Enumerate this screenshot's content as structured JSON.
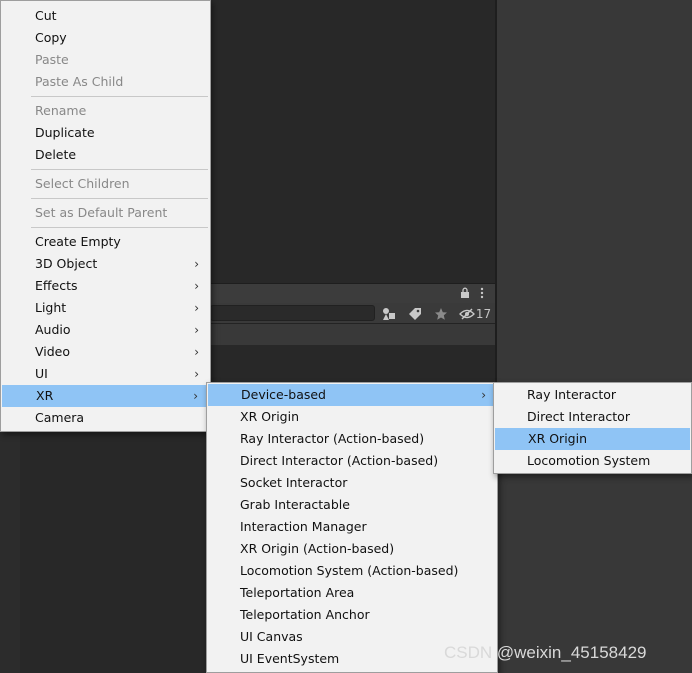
{
  "main_menu": {
    "items": [
      {
        "label": "Cut",
        "enabled": true
      },
      {
        "label": "Copy",
        "enabled": true
      },
      {
        "label": "Paste",
        "enabled": false
      },
      {
        "label": "Paste As Child",
        "enabled": false
      },
      {
        "label": "Rename",
        "enabled": false
      },
      {
        "label": "Duplicate",
        "enabled": true
      },
      {
        "label": "Delete",
        "enabled": true
      },
      {
        "label": "Select Children",
        "enabled": false
      },
      {
        "label": "Set as Default Parent",
        "enabled": false
      },
      {
        "label": "Create Empty",
        "enabled": true
      },
      {
        "label": "3D Object",
        "enabled": true,
        "submenu": true
      },
      {
        "label": "Effects",
        "enabled": true,
        "submenu": true
      },
      {
        "label": "Light",
        "enabled": true,
        "submenu": true
      },
      {
        "label": "Audio",
        "enabled": true,
        "submenu": true
      },
      {
        "label": "Video",
        "enabled": true,
        "submenu": true
      },
      {
        "label": "UI",
        "enabled": true,
        "submenu": true
      },
      {
        "label": "XR",
        "enabled": true,
        "submenu": true,
        "highlighted": true
      },
      {
        "label": "Camera",
        "enabled": true
      }
    ]
  },
  "xr_menu": {
    "items": [
      {
        "label": "Device-based",
        "submenu": true,
        "highlighted": true
      },
      {
        "label": "XR Origin"
      },
      {
        "label": "Ray Interactor (Action-based)"
      },
      {
        "label": "Direct Interactor (Action-based)"
      },
      {
        "label": "Socket Interactor"
      },
      {
        "label": "Grab Interactable"
      },
      {
        "label": "Interaction Manager"
      },
      {
        "label": "XR Origin (Action-based)"
      },
      {
        "label": "Locomotion System (Action-based)"
      },
      {
        "label": "Teleportation Area"
      },
      {
        "label": "Teleportation Anchor"
      },
      {
        "label": "UI Canvas"
      },
      {
        "label": "UI EventSystem"
      }
    ]
  },
  "device_menu": {
    "items": [
      {
        "label": "Ray Interactor"
      },
      {
        "label": "Direct Interactor"
      },
      {
        "label": "XR Origin",
        "highlighted": true
      },
      {
        "label": "Locomotion System"
      }
    ]
  },
  "toolbar": {
    "hidden_count": "17",
    "icons": [
      "lock-icon",
      "kebab-menu-icon",
      "scene-visibility-icon",
      "tag-icon",
      "star-icon",
      "hidden-eye-icon"
    ]
  },
  "submenu_arrow": "›",
  "watermark": "CSDN @weixin_45158429",
  "colors": {
    "highlight": "#8fc4f5",
    "menu_bg": "#f2f2f2",
    "disabled_text": "#888888",
    "editor_bg": "#282828"
  }
}
